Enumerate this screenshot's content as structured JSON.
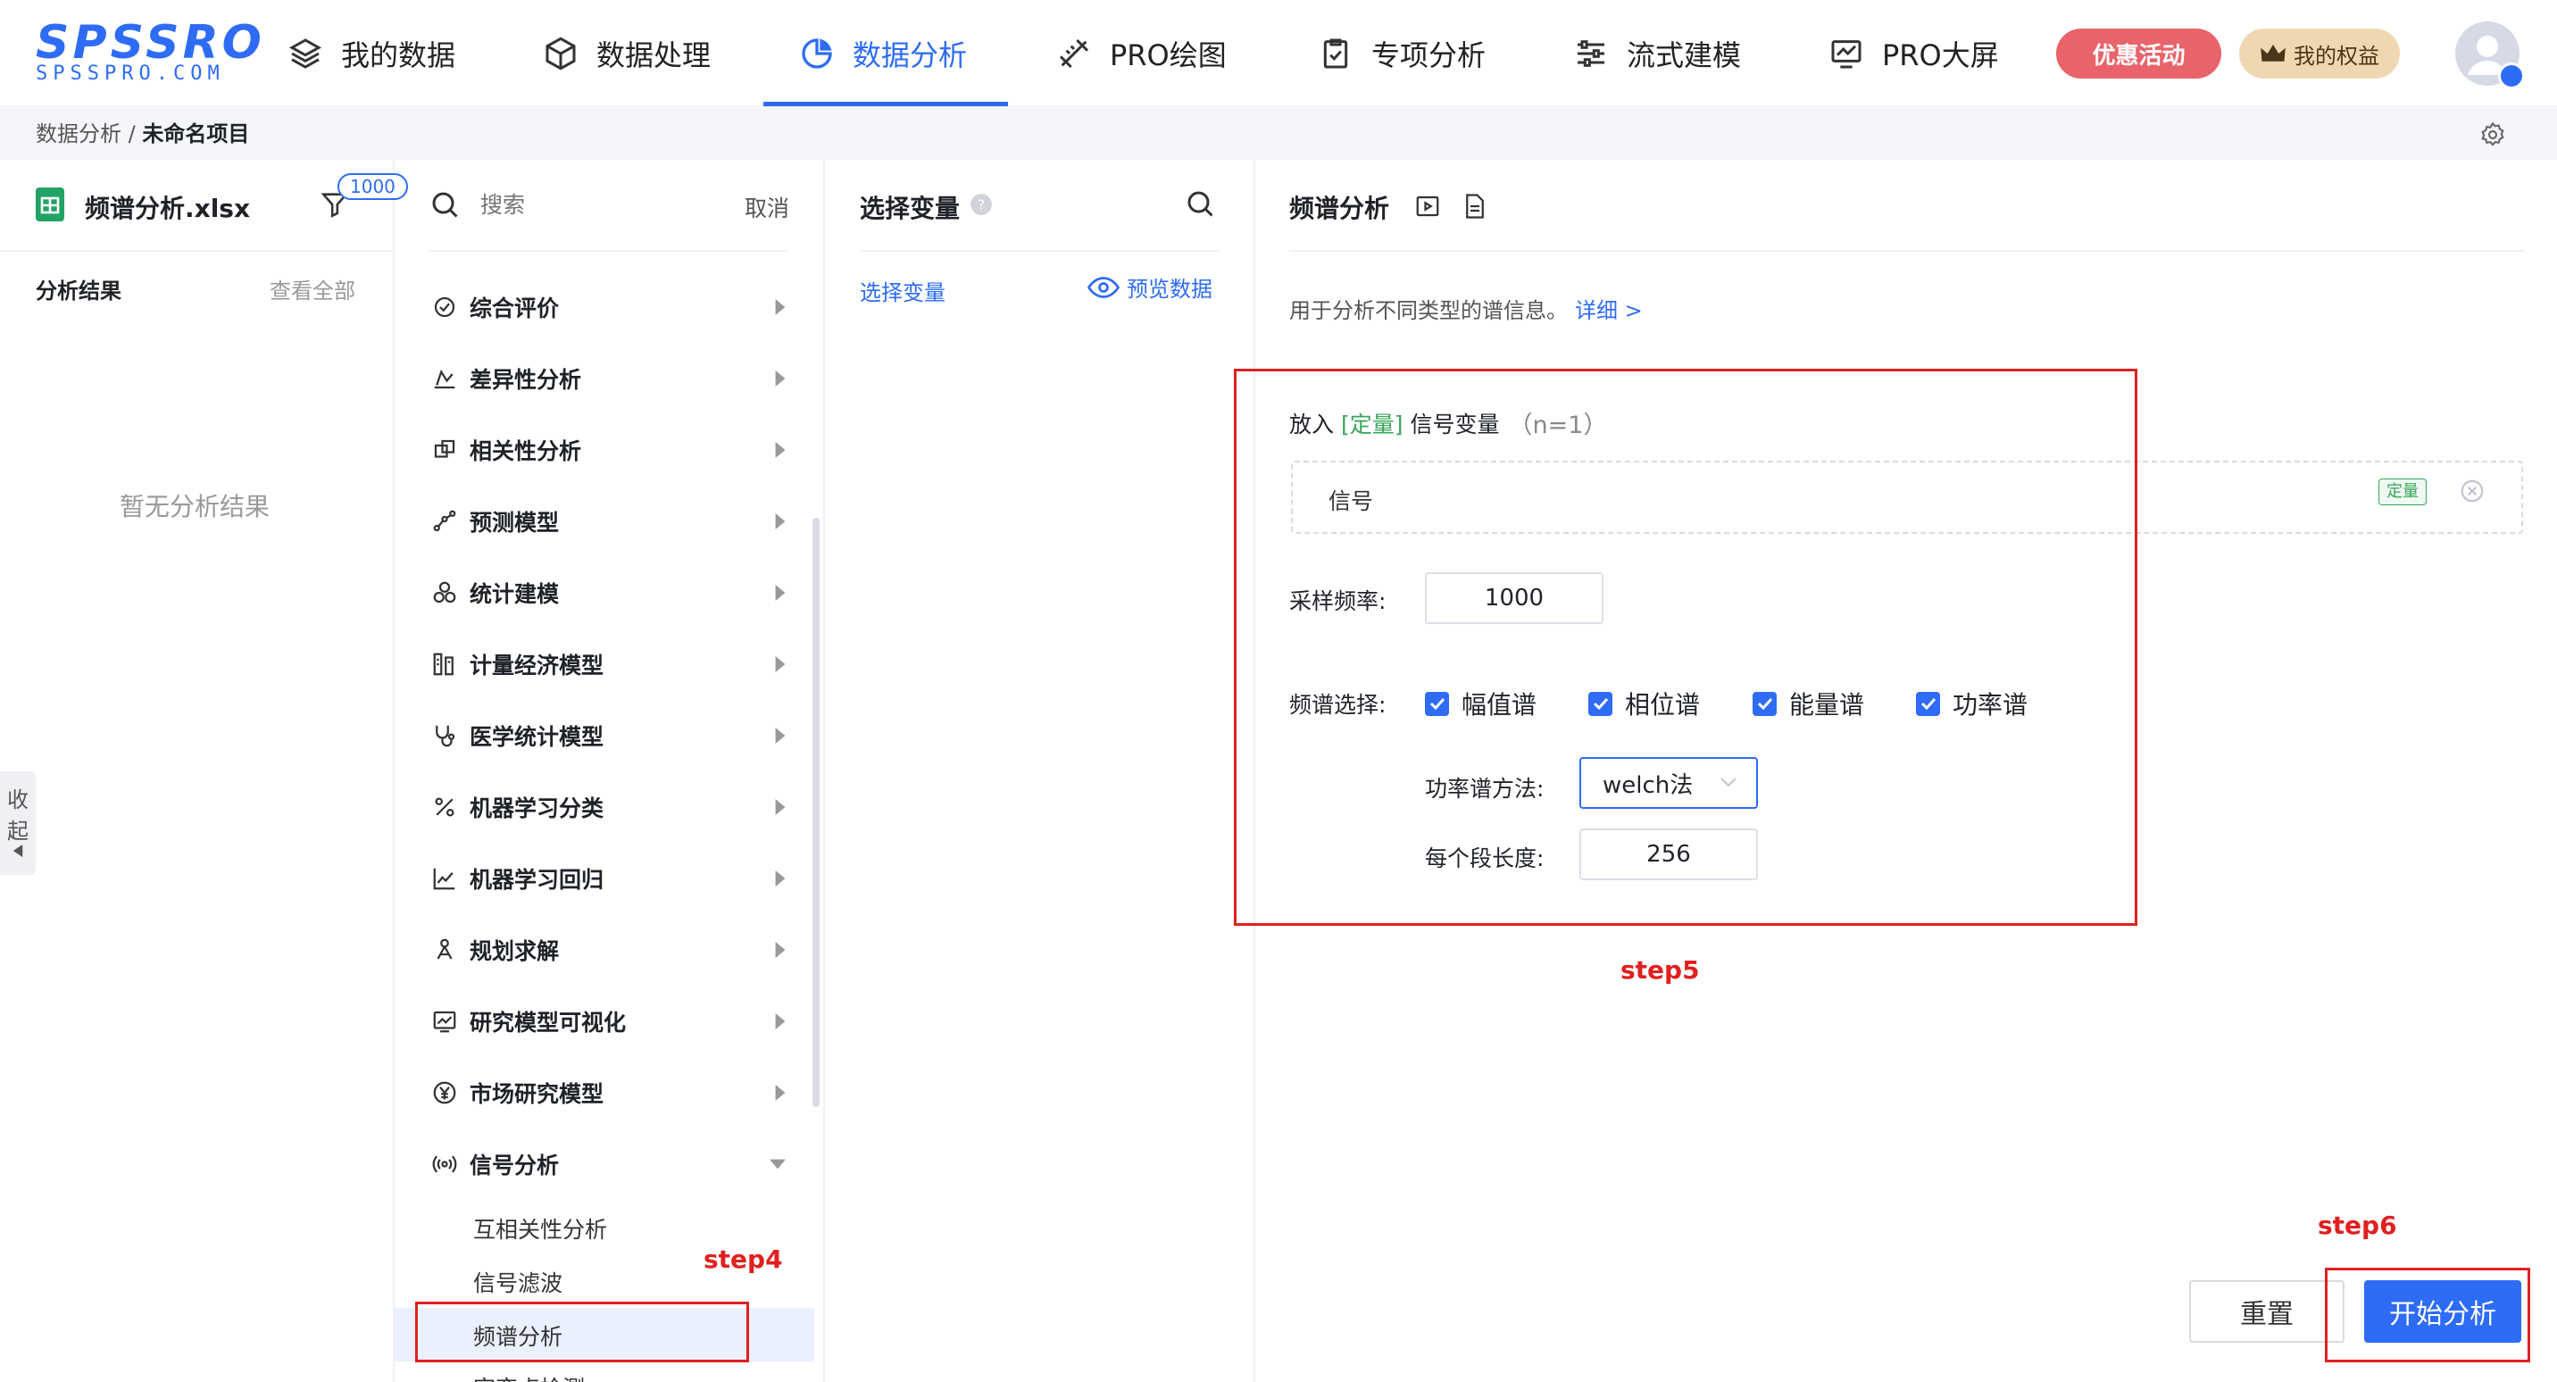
{
  "header": {
    "logo": "SPSSRO",
    "logo_sub": "SPSSPRO.COM",
    "nav": [
      {
        "label": "我的数据",
        "icon": "layers-icon"
      },
      {
        "label": "数据处理",
        "icon": "cube-icon"
      },
      {
        "label": "数据分析",
        "icon": "pie-chart-icon",
        "active": true
      },
      {
        "label": "PRO绘图",
        "icon": "ruler-pencil-icon"
      },
      {
        "label": "专项分析",
        "icon": "clipboard-check-icon"
      },
      {
        "label": "流式建模",
        "icon": "sliders-icon"
      },
      {
        "label": "PRO大屏",
        "icon": "monitor-chart-icon"
      }
    ],
    "promo_label": "优惠活动",
    "rights_label": "我的权益"
  },
  "breadcrumb": {
    "root": "数据分析",
    "sep": "/",
    "current": "未命名项目"
  },
  "file_panel": {
    "file_name": "频谱分析.xlsx",
    "badge": "1000",
    "results_label": "分析结果",
    "view_all": "查看全部",
    "empty": "暂无分析结果",
    "collapse": [
      "收",
      "起"
    ]
  },
  "menu": {
    "search_placeholder": "搜索",
    "cancel": "取消",
    "items": [
      {
        "label": "综合评价",
        "icon": "evaluation-icon"
      },
      {
        "label": "差异性分析",
        "icon": "difference-icon"
      },
      {
        "label": "相关性分析",
        "icon": "correlation-icon"
      },
      {
        "label": "预测模型",
        "icon": "forecast-icon"
      },
      {
        "label": "统计建模",
        "icon": "statistics-icon"
      },
      {
        "label": "计量经济模型",
        "icon": "econometric-icon"
      },
      {
        "label": "医学统计模型",
        "icon": "stethoscope-icon"
      },
      {
        "label": "机器学习分类",
        "icon": "percent-icon"
      },
      {
        "label": "机器学习回归",
        "icon": "regression-icon"
      },
      {
        "label": "规划求解",
        "icon": "planning-icon"
      },
      {
        "label": "研究模型可视化",
        "icon": "visualization-icon"
      },
      {
        "label": "市场研究模型",
        "icon": "yen-icon"
      },
      {
        "label": "信号分析",
        "icon": "signal-icon",
        "expanded": true
      }
    ],
    "sub_items": [
      "互相关性分析",
      "信号滤波",
      "频谱分析",
      "突变点检测"
    ]
  },
  "variables": {
    "title": "选择变量",
    "tab": "选择变量",
    "preview": "预览数据"
  },
  "analysis": {
    "title": "频谱分析",
    "description": "用于分析不同类型的谱信息。",
    "detail_link": "详细 >",
    "var_prefix": "放入",
    "var_tag": "[定量]",
    "var_name": "信号变量",
    "var_count": "（n=1）",
    "signal_name": "信号",
    "signal_tag": "定量",
    "sampling_label": "采样频率:",
    "sampling_value": "1000",
    "spectrum_label": "频谱选择:",
    "spectrum_options": [
      "幅值谱",
      "相位谱",
      "能量谱",
      "功率谱"
    ],
    "psd_method_label": "功率谱方法:",
    "psd_method_value": "welch法",
    "segment_label": "每个段长度:",
    "segment_value": "256",
    "reset": "重置",
    "start": "开始分析"
  },
  "annotations": {
    "step4": "step4",
    "step5": "step5",
    "step6": "step6"
  },
  "colors": {
    "brand": "#2e6cf6",
    "promo": "#e8646a",
    "rights": "#efd8b1",
    "annotation": "#e02020",
    "quant_tag": "#3aa55b"
  }
}
